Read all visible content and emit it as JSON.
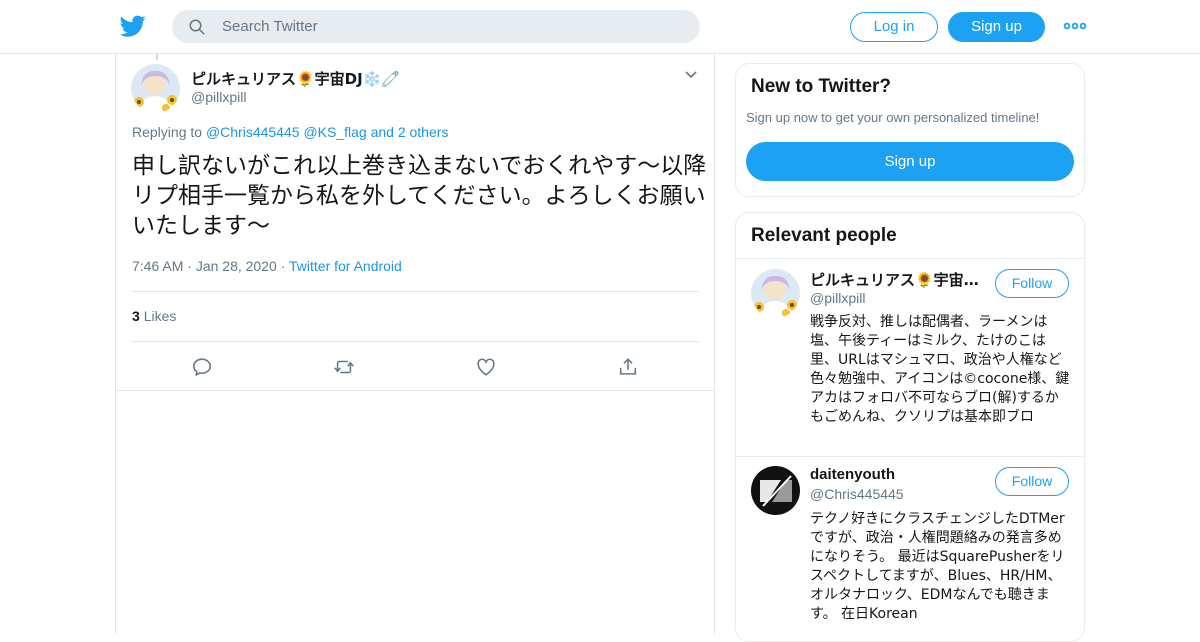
{
  "header": {
    "search_placeholder": "Search Twitter",
    "login_label": "Log in",
    "signup_label": "Sign up",
    "logo_icon": "twitter-bird-icon",
    "more_icon": "more-dots-icon",
    "search_icon": "search-icon"
  },
  "tweet": {
    "author_name": "ピルキュリアス🌻宇宙DJ❄️🧷",
    "author_handle": "@pillxpill",
    "replying_prefix": "Replying to",
    "replying_to": [
      "@Chris445445",
      "@KS_flag"
    ],
    "replying_others": "and 2 others",
    "text": "申し訳ないがこれ以上巻き込まないでおくれやす〜以降リプ相手一覧から私を外してください。よろしくお願いいたします〜",
    "time": "7:46 AM",
    "date": "Jan 28, 2020",
    "source": "Twitter for Android",
    "likes_count": "3",
    "likes_label": "Likes",
    "actions": [
      "reply-icon",
      "retweet-icon",
      "like-icon",
      "share-icon"
    ]
  },
  "sidebar": {
    "new_card": {
      "title": "New to Twitter?",
      "subtitle": "Sign up now to get your own personalized timeline!",
      "signup_label": "Sign up"
    },
    "relevant": {
      "title": "Relevant people",
      "people": [
        {
          "name": "ピルキュリアス🌻宇宙DJ❄️🧷",
          "handle": "@pillxpill",
          "follow_label": "Follow",
          "bio": "戦争反対、推しは配偶者、ラーメンは塩、午後ティーはミルク、たけのこは里、URLはマシュマロ、政治や人権など色々勉強中、アイコンは©cocone様、鍵アカはフォロバ不可ならブロ(解)するかもごめんね、クソリプは基本即ブロ"
        },
        {
          "name": "daitenyouth",
          "handle": "@Chris445445",
          "follow_label": "Follow",
          "bio": "テクノ好きにクラスチェンジしたDTMerですが、政治・人権問題絡みの発言多めになりそう。 最近はSquarePusherをリスペクトしてますが、Blues、HR/HM、オルタナロック、EDMなんでも聴きます。 在日Korean"
        }
      ]
    }
  },
  "colors": {
    "accent": "#1da1f2",
    "link": "#1b95e0",
    "secondary_text": "#657786",
    "border": "#e1e8ed"
  }
}
